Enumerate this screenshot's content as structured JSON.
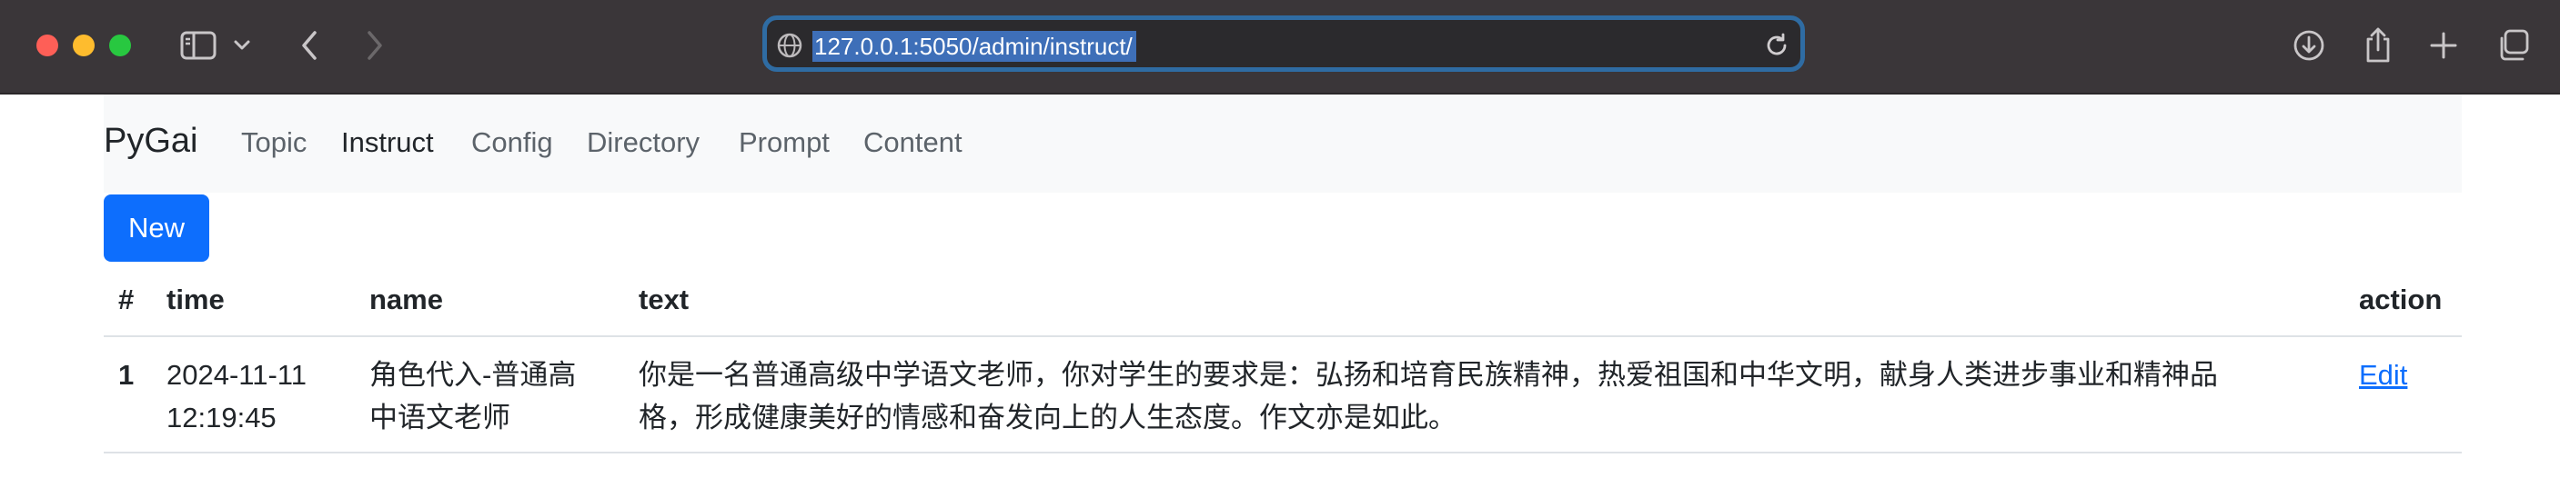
{
  "browser": {
    "url": "127.0.0.1:5050/admin/instruct/"
  },
  "navbar": {
    "brand": "PyGai",
    "links": [
      {
        "label": "Topic",
        "active": false
      },
      {
        "label": "Instruct",
        "active": true
      },
      {
        "label": "Config",
        "active": false
      },
      {
        "label": "Directory",
        "active": false
      },
      {
        "label": "Prompt",
        "active": false
      },
      {
        "label": "Content",
        "active": false
      }
    ]
  },
  "actions": {
    "new_label": "New"
  },
  "table": {
    "headers": [
      "#",
      "time",
      "name",
      "text",
      "action"
    ],
    "rows": [
      {
        "id": "1",
        "time_date": "2024-11-11",
        "time_clock": "12:19:45",
        "name_line1": "角色代入-普通高",
        "name_line2": "中语文老师",
        "text_line1": "你是一名普通高级中学语文老师，你对学生的要求是：弘扬和培育民族精神，热爱祖国和中华文明，献身人类进步事业和精神品",
        "text_line2": "格，形成健康美好的情感和奋发向上的人生态度。作文亦是如此。",
        "action": "Edit"
      }
    ]
  },
  "colors": {
    "chrome_bg": "#3a3639",
    "url_focus": "#2f6ca3",
    "url_selection": "#3e6fb8",
    "primary": "#0d6efd",
    "navbar_bg": "#f8f9fa"
  }
}
